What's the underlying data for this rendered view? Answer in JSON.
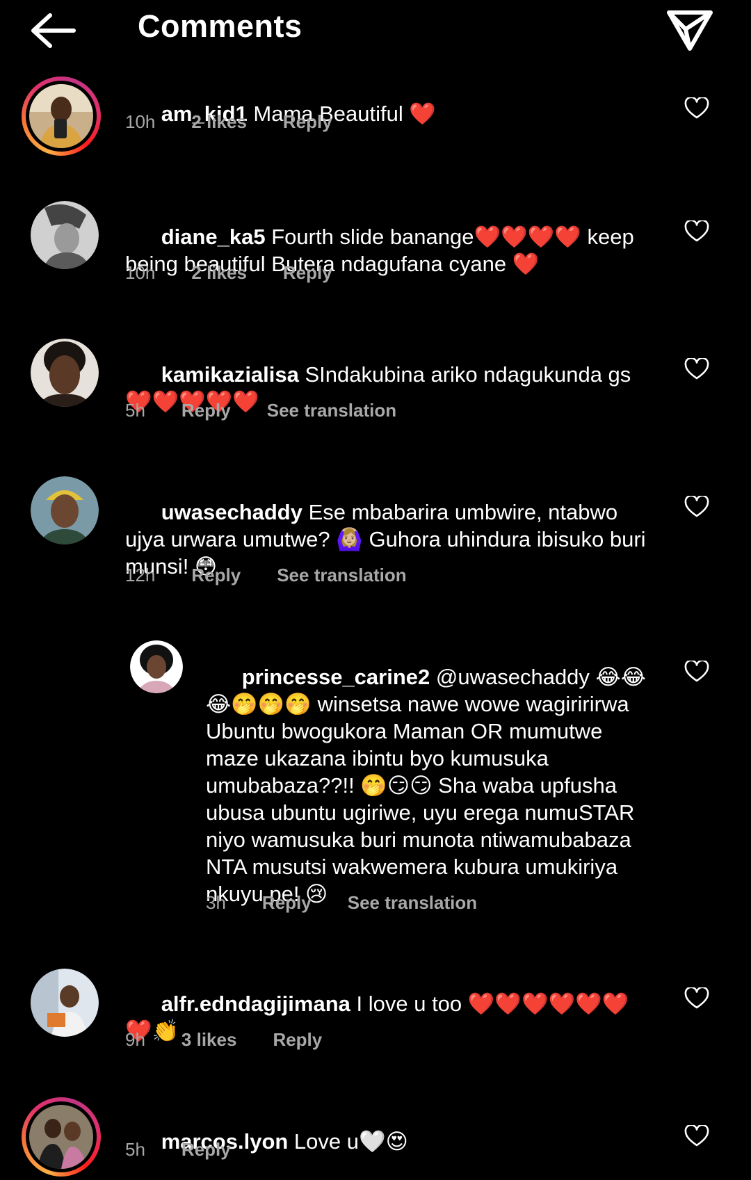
{
  "header": {
    "title": "Comments",
    "back_icon": "arrow-left-icon",
    "send_icon": "paper-plane-icon"
  },
  "labels": {
    "reply": "Reply",
    "see_translation": "See translation"
  },
  "comments": [
    {
      "username": "am_kid1",
      "text": " Mama Beautiful ❤️",
      "time": "10h",
      "likes": "2 likes",
      "story_ring": true
    },
    {
      "username": "diane_ka5",
      "text": " Fourth slide banange❤️❤️❤️❤️ keep being beautiful Butera ndagufana cyane ❤️",
      "time": "10h",
      "likes": "2 likes",
      "story_ring": false
    },
    {
      "username": "kamikazialisa",
      "text": " SIndakubina ariko ndagukunda gs❤️❤️❤️❤️❤️",
      "time": "5h",
      "translation": true,
      "story_ring": false
    },
    {
      "username": "uwasechaddy",
      "text": " Ese mbabarira umbwire, ntabwo ujya urwara umutwe? 🙆🏼‍♀️ Guhora uhindura ibisuko buri munsi! 😳",
      "time": "12h",
      "translation": true,
      "story_ring": false
    },
    {
      "username": "princesse_carine2",
      "text": " @uwasechaddy 😂😂😂🤭🤭🤭 winsetsa nawe wowe wagiririrwa Ubuntu bwogukora Maman OR mumutwe maze ukazana ibintu byo kumusuka umubabaza??!! 🤭😏😏 Sha waba upfusha ubusa ubuntu ugiriwe, uyu erega numuSTAR  niyo wamusuka buri munota ntiwamubabaza NTA musutsi wakwemera kubura umukiriya nkuyu pe! 😢",
      "time": "3h",
      "translation": true,
      "story_ring": false,
      "is_reply": true
    },
    {
      "username": "alfr.edndagijimana",
      "text": " I love u too ❤️❤️❤️❤️❤️❤️❤️👏",
      "time": "9h",
      "likes": "3 likes",
      "story_ring": false
    },
    {
      "username": "marcos.lyon",
      "text": " Love u🤍😍",
      "time": "5h",
      "story_ring": true
    }
  ],
  "colors": {
    "background": "#000000",
    "text": "#ffffff",
    "meta": "#a8a8a8"
  }
}
